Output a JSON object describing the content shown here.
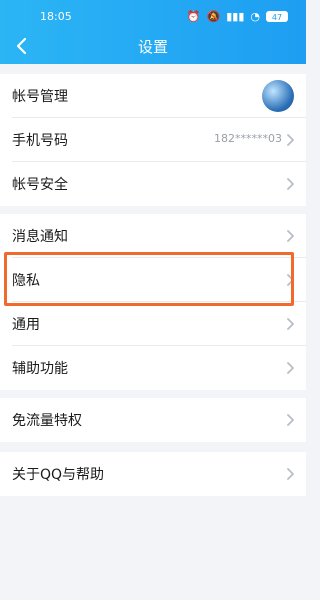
{
  "status_bar": {
    "time": "18:05",
    "battery": "47"
  },
  "header": {
    "title": "设置"
  },
  "groups": [
    {
      "items": [
        {
          "label": "帐号管理"
        },
        {
          "label": "手机号码",
          "value": "182******03"
        },
        {
          "label": "帐号安全"
        }
      ]
    },
    {
      "items": [
        {
          "label": "消息通知"
        },
        {
          "label": "隐私"
        },
        {
          "label": "通用"
        },
        {
          "label": "辅助功能"
        }
      ]
    },
    {
      "items": [
        {
          "label": "免流量特权"
        }
      ]
    },
    {
      "items": [
        {
          "label": "关于QQ与帮助"
        }
      ]
    }
  ],
  "colors": {
    "header": "#1e9ef2",
    "highlight": "#f06a2e",
    "background": "#f3f4f8"
  }
}
